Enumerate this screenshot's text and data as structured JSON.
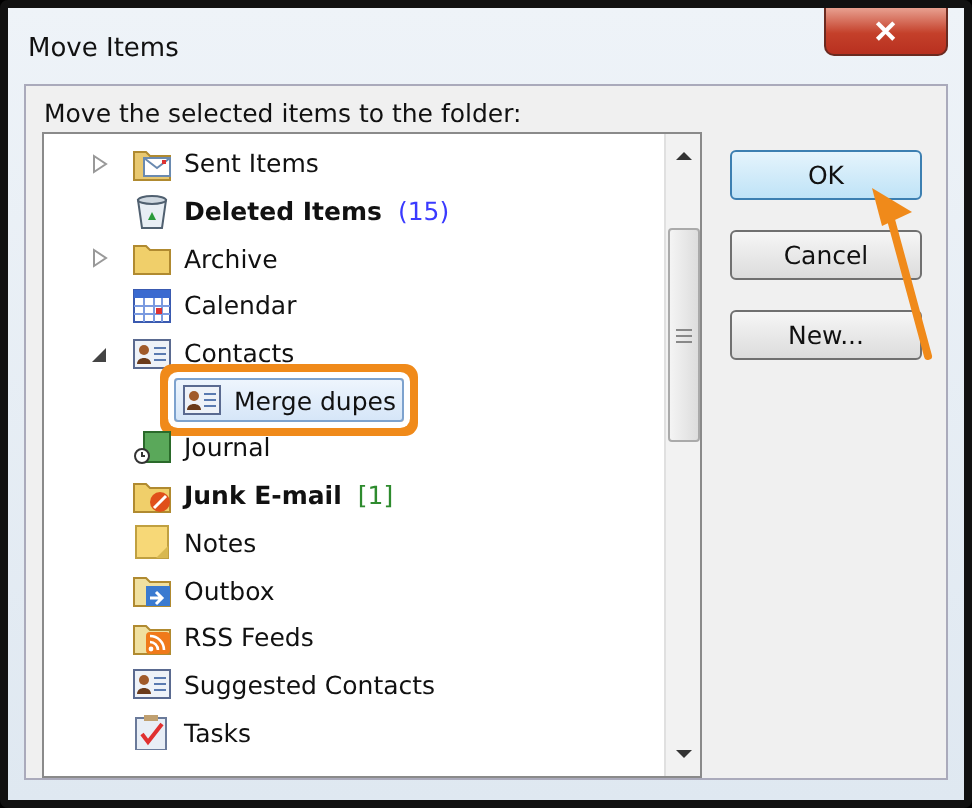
{
  "window": {
    "title": "Move Items",
    "close_glyph": "✕"
  },
  "prompt": "Move the selected items to the folder:",
  "folders": [
    {
      "name": "Sent Items",
      "kind": "sent",
      "expanded": false,
      "bold": false,
      "selected": false
    },
    {
      "name": "Deleted Items",
      "kind": "trash",
      "bold": true,
      "selected": false,
      "count": {
        "text": "(15)",
        "color": "#3a3aff"
      }
    },
    {
      "name": "Archive",
      "kind": "folder",
      "expanded": false,
      "bold": false,
      "selected": false
    },
    {
      "name": "Calendar",
      "kind": "calendar",
      "bold": false,
      "selected": false
    },
    {
      "name": "Contacts",
      "kind": "contact",
      "expanded": true,
      "bold": false,
      "selected": false,
      "children": [
        {
          "name": "Merge dupes",
          "kind": "contact",
          "bold": false,
          "selected": true
        }
      ]
    },
    {
      "name": "Journal",
      "kind": "journal",
      "bold": false,
      "selected": false
    },
    {
      "name": "Junk E-mail",
      "kind": "junk",
      "bold": true,
      "selected": false,
      "count": {
        "text": "[1]",
        "color": "#2e8b2e"
      }
    },
    {
      "name": "Notes",
      "kind": "notes",
      "bold": false,
      "selected": false
    },
    {
      "name": "Outbox",
      "kind": "outbox",
      "bold": false,
      "selected": false
    },
    {
      "name": "RSS Feeds",
      "kind": "rss",
      "bold": false,
      "selected": false
    },
    {
      "name": "Suggested Contacts",
      "kind": "contact",
      "bold": false,
      "selected": false
    },
    {
      "name": "Tasks",
      "kind": "tasks",
      "bold": false,
      "selected": false
    }
  ],
  "buttons": [
    {
      "label": "OK",
      "default": true
    },
    {
      "label": "Cancel",
      "default": false
    },
    {
      "label": "New...",
      "default": false
    }
  ]
}
